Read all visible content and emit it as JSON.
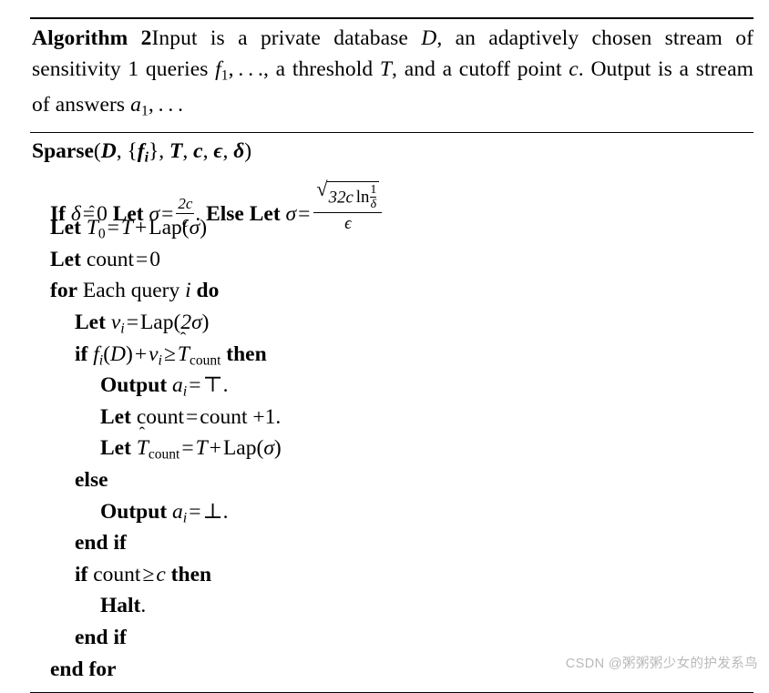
{
  "document": {
    "type": "algorithm-pseudocode",
    "algorithm_number": "2",
    "algorithm_label": "Algorithm 2",
    "caption_text": "Input is a private database D, an adaptively chosen stream of sensitivity 1 queries f₁,…, a threshold T, and a cutoff point c. Output is a stream of answers a₁,…",
    "procedure_name": "Sparse",
    "signature": "Sparse(D, {fᵢ}, T, c, ϵ, δ)"
  },
  "caption": {
    "algname": "Algorithm 2",
    "t1": "Input is a private database ",
    "v_D": "D",
    "t2": ", an adaptively chosen stream of sensitivity 1 queries ",
    "v_f": "f",
    "sub_1a": "1",
    "t3": ", . . ., a threshold ",
    "v_T": "T",
    "t4": ", and a cutoff point ",
    "v_c": "c",
    "t5": ". Output is a stream of answers ",
    "v_a": "a",
    "sub_1b": "1",
    "t6": ", . . ."
  },
  "signature": {
    "name": "Sparse",
    "open": "(",
    "arg_D": "D",
    "comma1": ", ",
    "brace_open": "{",
    "arg_f": "f",
    "arg_f_sub": "i",
    "brace_close": "}",
    "comma2": ", ",
    "arg_T": "T",
    "comma3": ", ",
    "arg_c": "c",
    "comma4": ", ",
    "arg_eps": "ϵ",
    "comma5": ", ",
    "arg_delta": "δ",
    "close": ")"
  },
  "lines": {
    "l1": {
      "indent": 1,
      "text": "If δ = 0 Let σ = 2c/ϵ. Else Let σ = √(32c ln(1/δ))/ϵ",
      "kw_if": "If",
      "sym_delta": "δ",
      "eq": "=",
      "zero": "0",
      "kw_let": "Let",
      "sym_sigma": "σ",
      "frac_num": "2c",
      "frac_den": "ϵ",
      "period": ".",
      "kw_else": "Else",
      "kw_let2": "Let",
      "sym_sigma2": "σ",
      "sqrt_radicand_a": "32c",
      "sqrt_radicand_ln": "ln",
      "sqrt_frac_num": "1",
      "sqrt_frac_den": "δ",
      "big_den": "ϵ"
    },
    "l2": {
      "indent": 1,
      "text": "Let T̂0 = T + Lap(σ)",
      "kw_let": "Let",
      "T_hat": "T",
      "hat": "ˆ",
      "sub0": "0",
      "eq": "=",
      "T": "T",
      "plus": "+",
      "lap": "Lap",
      "open": "(",
      "sigma": "σ",
      "close": ")"
    },
    "l3": {
      "indent": 1,
      "text": "Let count = 0",
      "kw_let": "Let",
      "count": "count",
      "eq": "=",
      "zero": "0"
    },
    "l4": {
      "indent": 1,
      "text": "for Each query i do",
      "kw_for": "for",
      "each_query": "Each query",
      "var_i": "i",
      "kw_do": "do"
    },
    "l5": {
      "indent": 2,
      "text": "Let νᵢ = Lap(2σ)",
      "kw_let": "Let",
      "nu": "ν",
      "sub_i": "i",
      "eq": "=",
      "lap": "Lap",
      "open": "(",
      "two_sigma": "2σ",
      "close": ")"
    },
    "l6": {
      "indent": 2,
      "text": "if fᵢ(D) + νᵢ ≥ T̂count then",
      "kw_if": "if",
      "f": "f",
      "sub_i1": "i",
      "open": "(",
      "D": "D",
      "close": ")",
      "plus": "+",
      "nu": "ν",
      "sub_i2": "i",
      "geq": "≥",
      "T_hat": "T",
      "hat": "ˆ",
      "sub_count": "count",
      "kw_then": "then"
    },
    "l7": {
      "indent": 3,
      "text": "Output aᵢ = ⊤.",
      "kw_output": "Output",
      "a": "a",
      "sub_i": "i",
      "eq": "=",
      "top": "⊤",
      "period": "."
    },
    "l8": {
      "indent": 3,
      "text": "Let count = count +1.",
      "kw_let": "Let",
      "count1": "count",
      "eq": "=",
      "count2": "count",
      "plus_one": "+1",
      "period": "."
    },
    "l9": {
      "indent": 3,
      "text": "Let T̂count = T + Lap(σ)",
      "kw_let": "Let",
      "T_hat": "T",
      "hat": "ˆ",
      "sub_count": "count",
      "eq": "=",
      "T": "T",
      "plus": "+",
      "lap": "Lap",
      "open": "(",
      "sigma": "σ",
      "close": ")"
    },
    "l10": {
      "indent": 2,
      "text": "else",
      "kw_else": "else"
    },
    "l11": {
      "indent": 3,
      "text": "Output aᵢ = ⊥.",
      "kw_output": "Output",
      "a": "a",
      "sub_i": "i",
      "eq": "=",
      "bot": "⊥",
      "period": "."
    },
    "l12": {
      "indent": 2,
      "text": "end if",
      "kw_end_if": "end if"
    },
    "l13": {
      "indent": 2,
      "text": "if count ≥ c then",
      "kw_if": "if",
      "count": "count",
      "geq": "≥",
      "var_c": "c",
      "kw_then": "then"
    },
    "l14": {
      "indent": 3,
      "text": "Halt.",
      "kw_halt": "Halt",
      "period": "."
    },
    "l15": {
      "indent": 2,
      "text": "end if",
      "kw_end_if": "end if"
    },
    "l16": {
      "indent": 1,
      "text": "end for",
      "kw_end_for": "end for"
    }
  },
  "watermark": {
    "text": "CSDN @粥粥粥少女的护发系鸟",
    "color": "#b9b9b9"
  }
}
